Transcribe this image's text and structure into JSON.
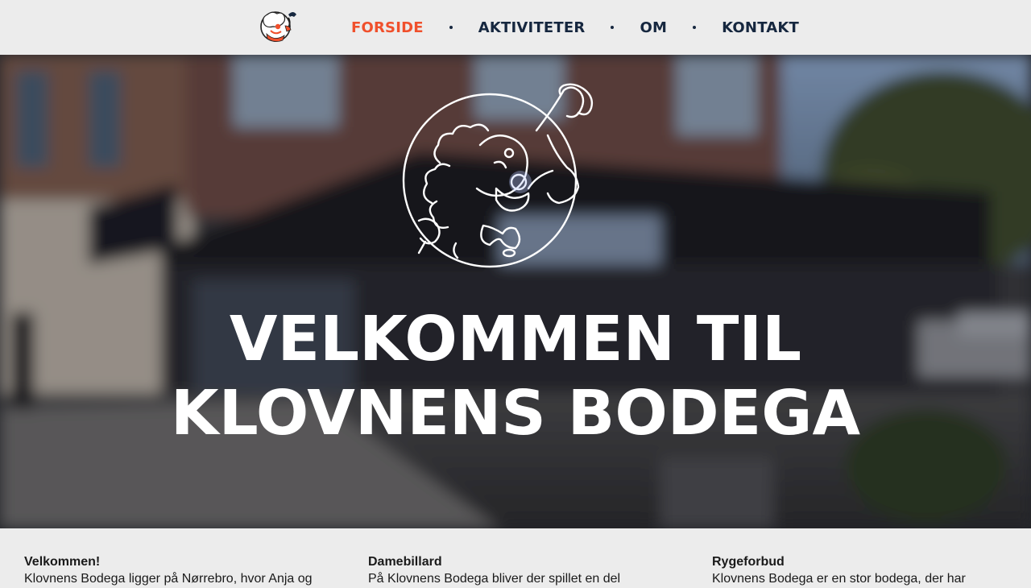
{
  "nav": {
    "items": [
      {
        "label": "FORSIDE",
        "active": true
      },
      {
        "label": "AKTIVITETER",
        "active": false
      },
      {
        "label": "OM",
        "active": false
      },
      {
        "label": "KONTAKT",
        "active": false
      }
    ],
    "accent_color": "#f0502c",
    "text_color": "#16273f"
  },
  "hero": {
    "title_line1": "VELKOMMEN TIL",
    "title_line2": "KLOVNENS BODEGA",
    "logo_icon": "clown-icon"
  },
  "columns": [
    {
      "heading": "Velkommen!",
      "text": "Klovnens Bodega ligger på Nørrebro, hvor Anja og"
    },
    {
      "heading": "Damebillard",
      "text": "På Klovnens Bodega bliver der spillet en del"
    },
    {
      "heading": "Rygeforbud",
      "text": "Klovnens Bodega er en stor bodega, der har"
    }
  ]
}
